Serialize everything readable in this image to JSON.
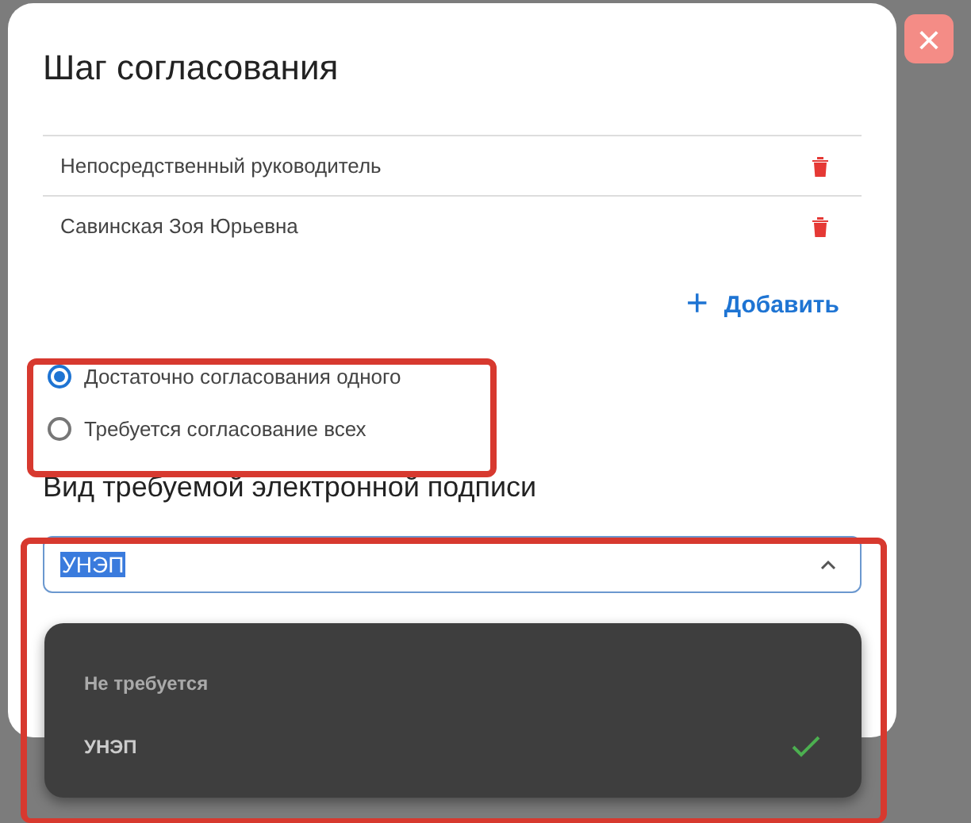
{
  "dialog": {
    "title": "Шаг согласования",
    "approvers": [
      {
        "name": "Непосредственный руководитель"
      },
      {
        "name": "Савинская Зоя Юрьевна"
      }
    ],
    "add_button": {
      "icon": "+",
      "label": "Добавить"
    },
    "approval_mode": [
      {
        "label": "Достаточно согласования одного",
        "selected": true
      },
      {
        "label": "Требуется согласование всех",
        "selected": false
      }
    ],
    "signature_heading": "Вид требуемой электронной подписи",
    "signature_select": {
      "value": "УНЭП",
      "text_selected": true,
      "expanded": true,
      "options": [
        {
          "label": "Не требуется",
          "selected": false
        },
        {
          "label": "УНЭП",
          "selected": true
        }
      ]
    }
  },
  "close_button": {
    "icon": "×"
  }
}
